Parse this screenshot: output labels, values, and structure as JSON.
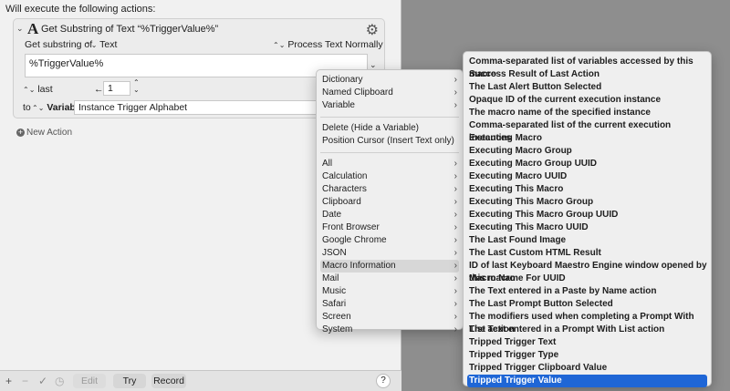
{
  "editor": {
    "header": "Will execute the following actions:",
    "action": {
      "icon": "A",
      "title": "Get Substring of Text “%TriggerValue%”",
      "get_substring_of": "Get substring of",
      "source_select": "Text",
      "process_select": "Process Text Normally",
      "text_value": "%TriggerValue%",
      "position_select": "last",
      "arrow_label": "←",
      "count_value": "1",
      "to_label": "to",
      "variable_select": "Variable",
      "variable_value": "Instance Trigger Alphabet"
    },
    "new_action": "New Action"
  },
  "toolbar": {
    "edit": "Edit",
    "try": "Try",
    "record": "Record",
    "help": "?"
  },
  "menu1": {
    "group1": [
      "Dictionary",
      "Named Clipboard",
      "Variable"
    ],
    "group2": [
      "Delete (Hide a Variable)",
      "Position Cursor (Insert Text only)"
    ],
    "group3": [
      "All",
      "Calculation",
      "Characters",
      "Clipboard",
      "Date",
      "Front Browser",
      "Google Chrome",
      "JSON",
      "Macro Information",
      "Mail",
      "Music",
      "Safari",
      "Screen",
      "System"
    ]
  },
  "menu2": {
    "items": [
      "Comma-separated list of variables accessed by this macro",
      "Success Result of Last Action",
      "The Last Alert Button Selected",
      "Opaque ID of the current execution instance",
      "The macro name of the specified instance",
      "Comma-separated list of the current execution instances",
      "Executing Macro",
      "Executing Macro Group",
      "Executing Macro Group UUID",
      "Executing Macro UUID",
      "Executing This Macro",
      "Executing This Macro Group",
      "Executing This Macro Group UUID",
      "Executing This Macro UUID",
      "The Last Found Image",
      "The Last Custom HTML Result",
      "ID of last Keyboard Maestro Engine window opened by this macro",
      "Macro Name For UUID",
      "The Text entered in a Paste by Name action",
      "The Last Prompt Button Selected",
      "The modifiers used when completing a Prompt With List action",
      "The Text entered in a Prompt With List action",
      "Tripped Trigger Text",
      "Tripped Trigger Type",
      "Tripped Trigger Clipboard Value",
      "Tripped Trigger Value"
    ]
  },
  "colors": {
    "selection": "#1f66d6",
    "hover": "#d7d7d7"
  }
}
